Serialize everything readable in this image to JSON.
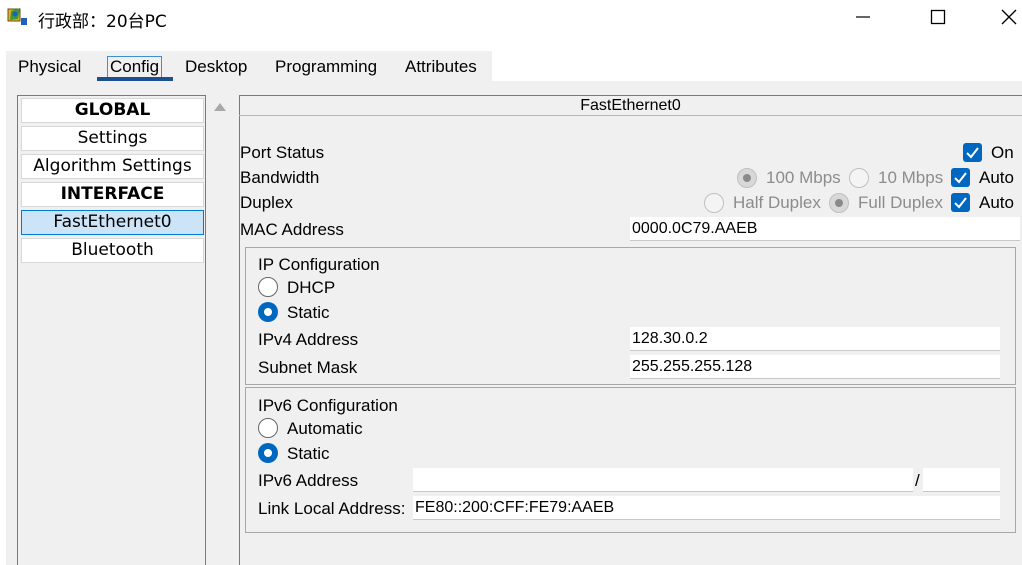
{
  "window": {
    "title": "行政部：20台PC",
    "icon": "packet-tracer-pc-icon"
  },
  "tabs": [
    "Physical",
    "Config",
    "Desktop",
    "Programming",
    "Attributes"
  ],
  "active_tab": "Config",
  "sidebar": {
    "items": [
      {
        "label": "GLOBAL",
        "bold": true
      },
      {
        "label": "Settings"
      },
      {
        "label": "Algorithm Settings"
      },
      {
        "label": "INTERFACE",
        "bold": true
      },
      {
        "label": "FastEthernet0",
        "selected": true
      },
      {
        "label": "Bluetooth"
      }
    ]
  },
  "panel": {
    "title": "FastEthernet0",
    "port_status_label": "Port Status",
    "port_status_on_label": "On",
    "bandwidth_label": "Bandwidth",
    "bandwidth_100": "100 Mbps",
    "bandwidth_10": "10 Mbps",
    "bandwidth_auto": "Auto",
    "duplex_label": "Duplex",
    "duplex_half": "Half Duplex",
    "duplex_full": "Full Duplex",
    "duplex_auto": "Auto",
    "mac_label": "MAC Address",
    "mac_value": "0000.0C79.AAEB"
  },
  "ipv4": {
    "group_title": "IP Configuration",
    "dhcp_label": "DHCP",
    "static_label": "Static",
    "address_label": "IPv4 Address",
    "address_value": "128.30.0.2",
    "mask_label": "Subnet Mask",
    "mask_value": "255.255.255.128"
  },
  "ipv6": {
    "group_title": "IPv6 Configuration",
    "auto_label": "Automatic",
    "static_label": "Static",
    "address_label": "IPv6 Address",
    "address_value": "",
    "slash": "/",
    "prefix_value": "",
    "link_local_label": "Link Local Address:",
    "link_local_value": "FE80::200:CFF:FE79:AAEB"
  },
  "colors": {
    "accent": "#0067c0",
    "selected_bg": "#cce4f7",
    "panel_bg": "#f0f0f0"
  }
}
